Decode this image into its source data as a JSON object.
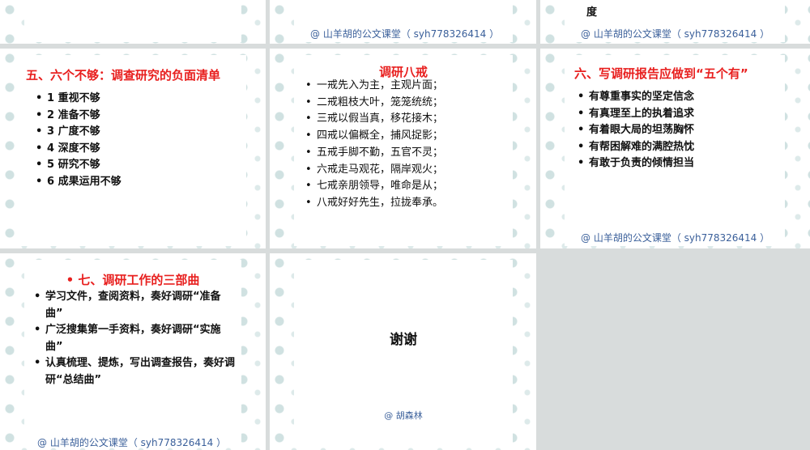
{
  "footer": "@ 山羊胡的公文课堂（ syh778326414 ）",
  "slide_top_right_tail": "度",
  "slide5": {
    "title": "五、六个不够：调查研究的负面清单",
    "items": [
      "1 重视不够",
      "2 准备不够",
      "3 广度不够",
      "4 深度不够",
      "5 研究不够",
      "6 成果运用不够"
    ]
  },
  "slide6": {
    "title": "调研八戒",
    "items": [
      "一戒先入为主，主观片面；",
      "二戒粗枝大叶，笼笼统统；",
      "三戒以假当真，移花接木；",
      "四戒以偏概全，捕风捉影；",
      "五戒手脚不勤，五官不灵；",
      "六戒走马观花，隔岸观火；",
      "七戒亲朋领导，唯命是从；",
      "八戒好好先生，拉拢奉承。"
    ]
  },
  "slide7": {
    "title": "六、写调研报告应做到“五个有”",
    "items": [
      "有尊重事实的坚定信念",
      "有真理至上的执着追求",
      "有着眼大局的坦荡胸怀",
      "有帮困解难的满腔热忱",
      "有敢于负责的倾情担当"
    ]
  },
  "slide8": {
    "title": "• 七、调研工作的三部曲",
    "items": [
      "学习文件，查阅资料，奏好调研“准备曲”",
      "广泛搜集第一手资料，奏好调研“实施曲”",
      "认真梳理、提炼，写出调查报告，奏好调研“总结曲”"
    ]
  },
  "slide9": {
    "title": "谢谢",
    "author": "@ 胡森林"
  },
  "colors": {
    "accent_red": "#e8201f",
    "footer_blue": "#3a5f9a"
  }
}
